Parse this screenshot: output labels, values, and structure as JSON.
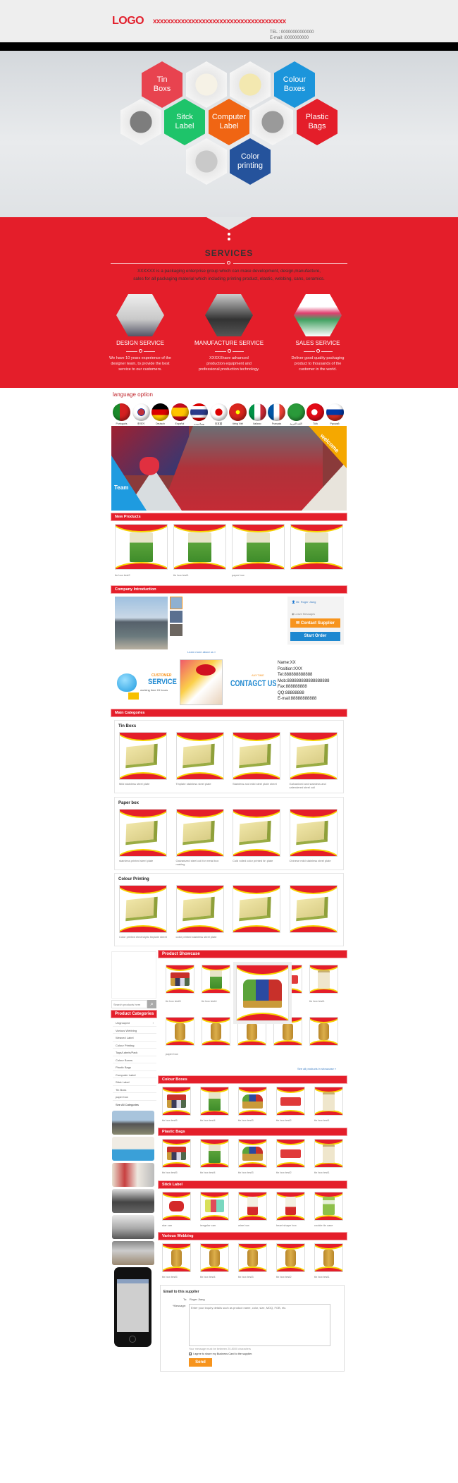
{
  "header": {
    "logo": "LOGO",
    "slogan": "xxxxxxxxxxxxxxxxxxxxxxxxxxxxxxxxxxxxxx",
    "tel": "TEL : 00000000000000",
    "email": "E-mail: i0000000000"
  },
  "hexes": [
    {
      "label": "Tin Boxs",
      "color": "#e8434f"
    },
    {
      "label": "Colour Boxes",
      "color": "#1c95db"
    },
    {
      "label": "Sitck Label",
      "color": "#1ec46a"
    },
    {
      "label": "Computer Label",
      "color": "#f06513"
    },
    {
      "label": "Plastic Bags",
      "color": "#e41e2a"
    },
    {
      "label": "Color printing",
      "color": "#25539c"
    }
  ],
  "services": {
    "title": "SERVICES",
    "desc1": "XXXXXX is a packaging enterprise group which can make development, design,manufacture,",
    "desc2": "sales for all packaging material which including printing product, elastic, webbing, cans, ceramics.",
    "items": [
      {
        "title": "DESIGN SERVICE",
        "lines": [
          "We have 10 years experience of the",
          "designer team, to provide the best",
          "service to our customers."
        ]
      },
      {
        "title": "MANUFACTURE SERVICE",
        "lines": [
          "XXXXXhave advanced",
          "production equipment and",
          "professional production technology."
        ]
      },
      {
        "title": "SALES SERVICE",
        "lines": [
          "Deliver good quality packaging",
          "product to thousands of the",
          "customer in the world."
        ]
      }
    ]
  },
  "language": {
    "title": "language option",
    "flags": [
      "Português",
      "한국어",
      "Deutsch",
      "Español",
      "ภาษาไทย",
      "日本語",
      "tiếng Việt",
      "Italiano",
      "Français",
      "اللغة العربية",
      "Türk",
      "Русский"
    ]
  },
  "banner": {
    "team": "Team",
    "welcome": "welcome"
  },
  "new_products": {
    "title": "New Products",
    "items": [
      "tin box test2",
      "tin box test1",
      "paper box",
      ""
    ]
  },
  "company": {
    "title": "Company Introduction",
    "contact_name": "Mr. Roger Jiang",
    "leave": "Leave Messages",
    "contact_btn": "Contact Supplier",
    "order_btn": "Start Order",
    "learn": "Learn more about us »"
  },
  "customer_service": {
    "customer": "CUSTOMER",
    "service": "SERVICE",
    "hours": "working time 24 hours",
    "anytime": "ANYTIME",
    "contact": "CONTAGCT US",
    "lines": [
      "Name:XX",
      "Position:XXX",
      "Tel:888888888888",
      "Mob:888888888888888888",
      "Fax:888888888",
      "QQ:88888888",
      "E-mail:88888888888"
    ]
  },
  "main_categories": {
    "title": "Main Categories",
    "panels": [
      {
        "title": "Tin Boxs",
        "items": [
          "Mild stainless steel plate",
          "Tinplate stainless steel plate",
          "Stainless and mild steel plate sheet",
          "Galvanized and stainless and calendered steel coil"
        ]
      },
      {
        "title": "Paper box",
        "items": [
          "stainless printed steel plate",
          "Galvanized steel coil for metal box making",
          "Cold rolled color printed tin plate",
          "Chinese mild stainless steel plate"
        ]
      },
      {
        "title": "Colour Printing",
        "items": [
          "Color printed electrolytic tinplate sheet",
          "color printed stainless steel plate",
          "",
          ""
        ]
      }
    ]
  },
  "sidebar": {
    "search_placeholder": "Search products here",
    "categories_title": "Product Categories",
    "categories": [
      "Ungrouped",
      "Various Webbing",
      "Weaved Label",
      "Colour Printing",
      "Tags/Labels/Pack",
      "Colour Boxes",
      "Plastic Bags",
      "Computer Label",
      "Stick Label",
      "Tin Boxs",
      "paper box",
      "See All Categories"
    ]
  },
  "showcase": {
    "title": "Product Showcase",
    "row1": [
      "tin box test5",
      "tin box test4",
      "",
      "",
      "tin box test1"
    ],
    "row2": [
      "paper box",
      "",
      "",
      "",
      ""
    ],
    "see_all": "See all products in showcase »"
  },
  "sections": [
    {
      "title": "Colour Boxes",
      "items": [
        "tin box test5",
        "tin box test4",
        "tin box test3",
        "tin box test2",
        "tin box test1"
      ]
    },
    {
      "title": "Plastic Bags",
      "items": [
        "tin box test5",
        "tin box test4",
        "tin box test3",
        "tin box test2",
        "tin box test1"
      ]
    },
    {
      "title": "Stick Label",
      "items": [
        "star can",
        "irregular can",
        "wine box",
        "heart shape box",
        "cookie tin case"
      ]
    },
    {
      "title": "Various Webbing",
      "items": [
        "tin box test5",
        "tin box test4",
        "tin box test3",
        "tin box test2",
        "tin box test1"
      ]
    }
  ],
  "email_form": {
    "title": "Email to this supplier",
    "to_label": "To:",
    "to_value": "Roger Jiang",
    "message_label": "*Message:",
    "placeholder": "Enter your inquiry details such as product name, color, size, MOQ, FOB, etc.",
    "hint": "Your message must be between 20-8000 characters",
    "agree": "I agree to share my Business Card to the supplier.",
    "send": "Send"
  },
  "colors": {
    "brand_red": "#e41e2a",
    "orange": "#f7941d",
    "blue": "#1e88d0"
  }
}
